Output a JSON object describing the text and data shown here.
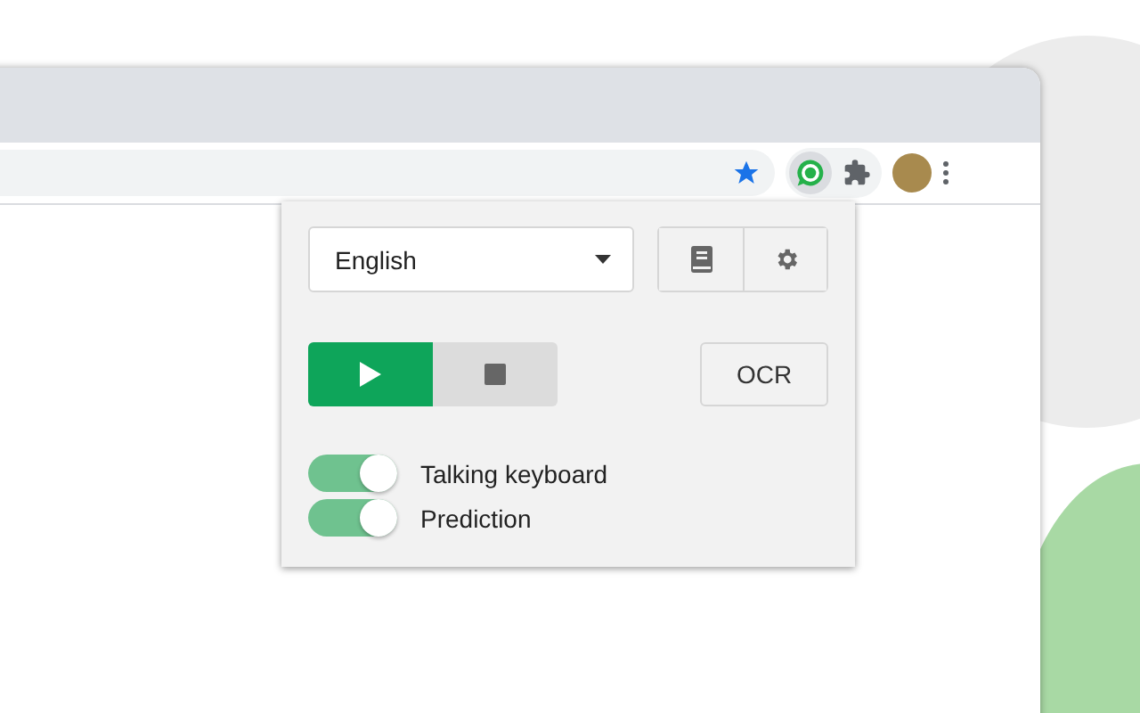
{
  "language_select": {
    "value": "English"
  },
  "playback": [
    {
      "kind": "play",
      "selected": true
    },
    {
      "kind": "stop",
      "selected": false
    }
  ],
  "ocr_button": {
    "label": "OCR"
  },
  "toggles": [
    {
      "label": "Talking keyboard",
      "on": true
    },
    {
      "label": "Prediction",
      "on": true
    }
  ]
}
